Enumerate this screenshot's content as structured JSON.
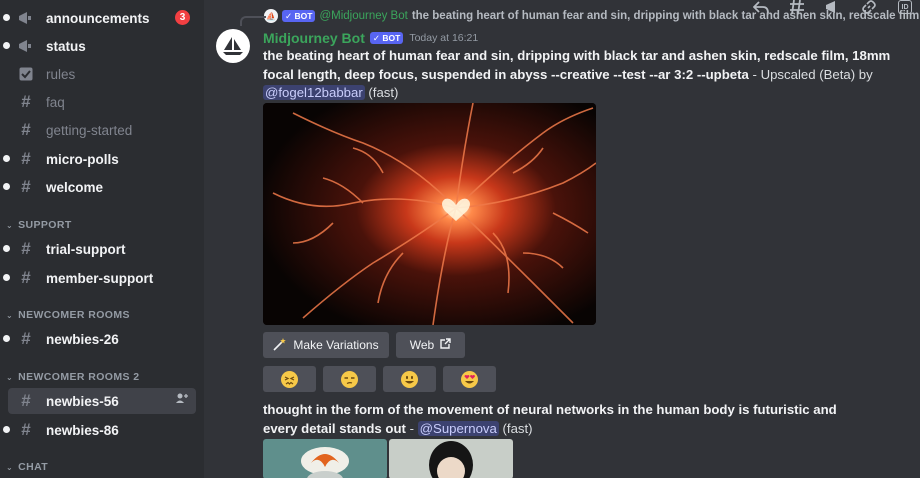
{
  "sidebar": {
    "channels": [
      {
        "name": "announcements",
        "badge": "3"
      },
      {
        "name": "status"
      },
      {
        "name": "rules"
      },
      {
        "name": "faq"
      },
      {
        "name": "getting-started"
      },
      {
        "name": "micro-polls"
      },
      {
        "name": "welcome"
      }
    ],
    "categories": [
      "SUPPORT",
      "NEWCOMER ROOMS",
      "NEWCOMER ROOMS 2",
      "CHAT"
    ],
    "support": [
      "trial-support",
      "member-support"
    ],
    "newcomer": [
      "newbies-26"
    ],
    "newcomer2": [
      "newbies-56",
      "newbies-86"
    ]
  },
  "reply": {
    "bot_tag": "BOT",
    "name": "@Midjourney Bot",
    "text": "the beating heart of human fear and sin, dripping with black tar and ashen skin, redscale film..."
  },
  "message": {
    "author": "Midjourney Bot",
    "bot_tag": "BOT",
    "timestamp": "Today at 16:21",
    "prompt": "the beating heart of human fear and sin, dripping with black tar and ashen skin, redscale film, 18mm focal length, deep focus, suspended in abyss --creative --test --ar 3:2 --upbeta",
    "suffix": " - Upscaled (Beta) by ",
    "mention": "@fogel12babbar",
    "speed": " (fast)",
    "buttons": {
      "variations": "Make Variations",
      "web": "Web"
    }
  },
  "message2": {
    "prompt": "thought in the form of the movement of neural networks in the human body is futuristic and every detail stands out",
    "dash": " - ",
    "mention": "@Supernova",
    "speed": " (fast)"
  },
  "colors": {
    "accent": "#5865f2",
    "bot_name": "#3ba55c",
    "badge": "#f23f42"
  }
}
